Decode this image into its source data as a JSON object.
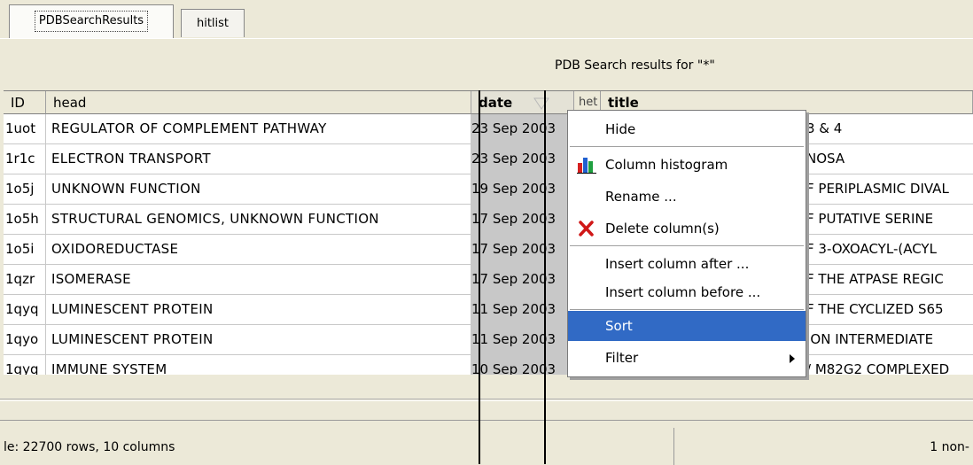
{
  "tabs": [
    {
      "label": "PDBSearchResults"
    },
    {
      "label": "hitlist"
    }
  ],
  "subtitle": "PDB Search results for \"*\"",
  "columns": {
    "id": "ID",
    "head": "head",
    "date": "date",
    "het": "het",
    "title": "title"
  },
  "rows": [
    {
      "id": "1uot",
      "head": "REGULATOR OF COMPLEMENT PATHWAY",
      "date": "23 Sep 2003",
      "title": "3 & 4"
    },
    {
      "id": "1r1c",
      "head": "ELECTRON TRANSPORT",
      "date": "23 Sep 2003",
      "title": "NOSA"
    },
    {
      "id": "1o5j",
      "head": "UNKNOWN FUNCTION",
      "date": "19 Sep 2003",
      "title": "F PERIPLASMIC DIVAL"
    },
    {
      "id": "1o5h",
      "head": "STRUCTURAL GENOMICS, UNKNOWN FUNCTION",
      "date": "17 Sep 2003",
      "title": "F PUTATIVE SERINE"
    },
    {
      "id": "1o5i",
      "head": "OXIDOREDUCTASE",
      "date": "17 Sep 2003",
      "title": "F 3-OXOACYL-(ACYL"
    },
    {
      "id": "1qzr",
      "head": "ISOMERASE",
      "date": "17 Sep 2003",
      "title": "F THE ATPASE REGIC"
    },
    {
      "id": "1qyq",
      "head": "LUMINESCENT PROTEIN",
      "date": "11 Sep 2003",
      "title": "F THE CYCLIZED S65"
    },
    {
      "id": "1qyo",
      "head": "LUMINESCENT PROTEIN",
      "date": "11 Sep 2003",
      "title": "ION INTERMEDIATE"
    },
    {
      "id": "1qyq",
      "head": "IMMUNE SYSTEM",
      "date": "10 Sep 2003",
      "title": "/ M82G2 COMPLEXED"
    }
  ],
  "context_menu": {
    "items": [
      {
        "label": "Hide",
        "icon": "none"
      },
      {
        "label": "Column histogram",
        "icon": "histogram-icon"
      },
      {
        "label": "Rename ...",
        "icon": "none"
      },
      {
        "label": "Delete column(s)",
        "icon": "delete-x-icon"
      },
      {
        "label": "Insert column after ...",
        "icon": "none"
      },
      {
        "label": "Insert column before ...",
        "icon": "none"
      },
      {
        "label": "Sort",
        "icon": "none",
        "highlighted": true
      },
      {
        "label": "Filter",
        "icon": "submenu-arrow"
      }
    ]
  },
  "status": {
    "left": "le: 22700 rows, 10 columns",
    "right": "1 non-"
  },
  "colors": {
    "menu_highlight": "#316ac5",
    "sorted_column_bg": "#c8c8c8",
    "chrome": "#ece9d8"
  }
}
